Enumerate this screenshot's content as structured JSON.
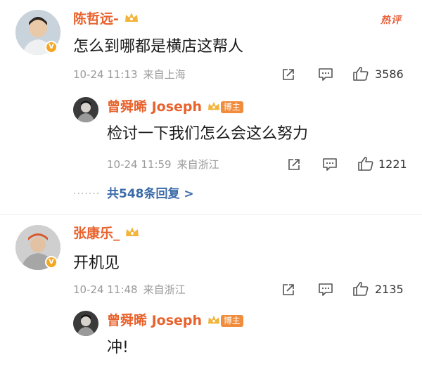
{
  "hot_tag": "热评",
  "comments": [
    {
      "username": "陈哲远-",
      "text": "怎么到哪都是横店这帮人",
      "date": "10-24 11:13",
      "location": "来自上海",
      "likes": "3586",
      "reply": {
        "username": "曾舜晞 Joseph",
        "role_badge": "博主",
        "text": "检讨一下我们怎么会这么努力",
        "date": "10-24 11:59",
        "location": "来自浙江",
        "likes": "1221"
      },
      "more_replies": "共548条回复 >"
    },
    {
      "username": "张康乐_",
      "text": "开机见",
      "date": "10-24 11:48",
      "location": "来自浙江",
      "likes": "2135",
      "reply": {
        "username": "曾舜晞 Joseph",
        "role_badge": "博主",
        "text": "冲!"
      }
    }
  ],
  "icons": [
    "share-icon",
    "comment-icon",
    "like-icon",
    "crown-badge-icon",
    "verified-badge-icon"
  ],
  "colors": {
    "username": "#e8622c",
    "more_link": "#3a6aa8",
    "meta": "#9a9a9a",
    "badge": "#f08c3c"
  }
}
